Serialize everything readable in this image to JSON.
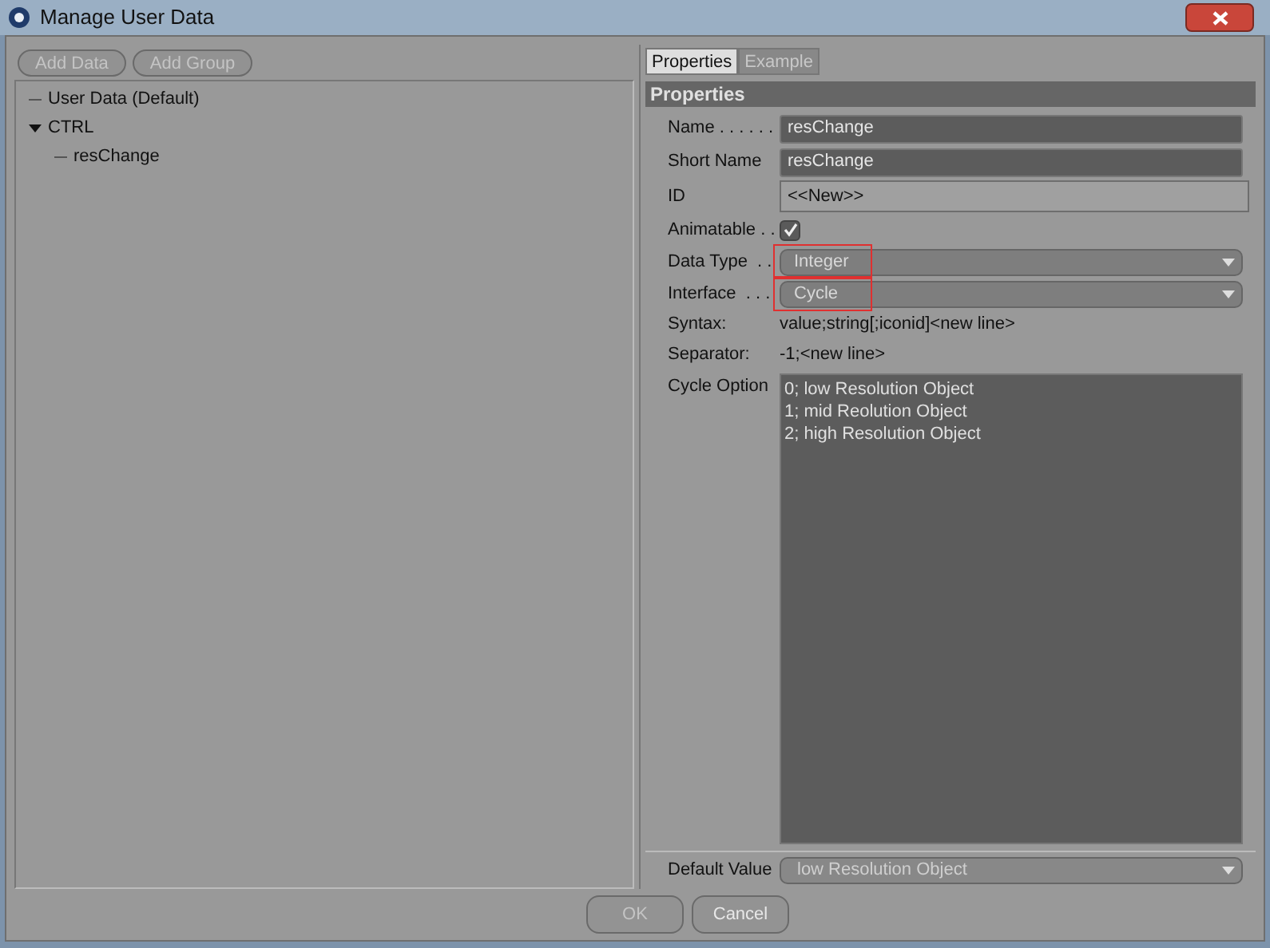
{
  "window": {
    "title": "Manage User Data"
  },
  "toolbar": [
    {
      "label": "Add Data",
      "disabled": true
    },
    {
      "label": "Add Group",
      "disabled": true
    }
  ],
  "tree": [
    {
      "label": "User Data (Default)"
    },
    {
      "label": "CTRL",
      "expanded": true,
      "children": [
        {
          "label": "resChange"
        }
      ]
    }
  ],
  "tabs": [
    {
      "label": "Properties",
      "selected": true
    },
    {
      "label": "Example",
      "selected": false
    }
  ],
  "section": "Properties",
  "fields": [
    {
      "kind": "text",
      "label": "Name . . . . . .",
      "value": "resChange"
    },
    {
      "kind": "text",
      "label": "Short Name",
      "value": "resChange"
    },
    {
      "kind": "readonly",
      "label": "ID",
      "value": "<<New>>"
    },
    {
      "kind": "checkbox",
      "label": "Animatable . .",
      "checked": true
    },
    {
      "kind": "dropdown",
      "label": "Data Type  . .",
      "value": "Integer",
      "highlighted": true
    },
    {
      "kind": "dropdown",
      "label": "Interface  . . .",
      "value": "Cycle",
      "highlighted": true
    },
    {
      "kind": "static",
      "label": "Syntax:",
      "value": "value;string[;iconid]<new line>"
    },
    {
      "kind": "static",
      "label": "Separator:",
      "value": "-1;<new line>"
    },
    {
      "kind": "textarea",
      "label": "Cycle Option",
      "lines": [
        "0; low Resolution Object",
        "1; mid Reolution Object",
        "2; high Resolution Object"
      ]
    }
  ],
  "default_value": {
    "label": "Default Value",
    "value": "low Resolution Object"
  },
  "buttons": [
    {
      "label": "OK",
      "disabled": true
    },
    {
      "label": "Cancel",
      "disabled": false
    }
  ]
}
